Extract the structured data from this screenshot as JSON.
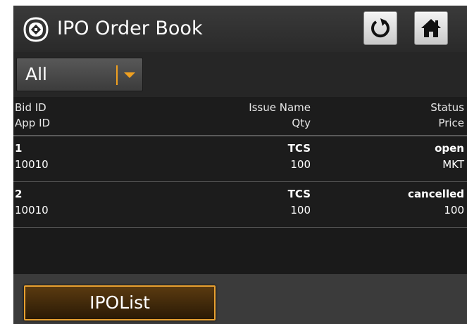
{
  "header": {
    "title": "IPO Order Book",
    "logo_icon": "app-logo-icon",
    "refresh_icon": "refresh-icon",
    "home_icon": "home-icon"
  },
  "filter": {
    "selected": "All",
    "arrow_icon": "chevron-down-icon"
  },
  "table": {
    "headers": {
      "bid_id": "Bid ID",
      "app_id": "App ID",
      "issue_name": "Issue Name",
      "qty": "Qty",
      "status": "Status",
      "price": "Price"
    },
    "rows": [
      {
        "bid_id": "1",
        "app_id": "10010",
        "issue_name": "TCS",
        "qty": "100",
        "status": "open",
        "price": "MKT"
      },
      {
        "bid_id": "2",
        "app_id": "10010",
        "issue_name": "TCS",
        "qty": "100",
        "status": "cancelled",
        "price": "100"
      }
    ]
  },
  "footer": {
    "ipolist_label": "IPOList"
  },
  "colors": {
    "accent": "#f0a020",
    "background": "#1e1e1e",
    "text": "#ffffff"
  }
}
